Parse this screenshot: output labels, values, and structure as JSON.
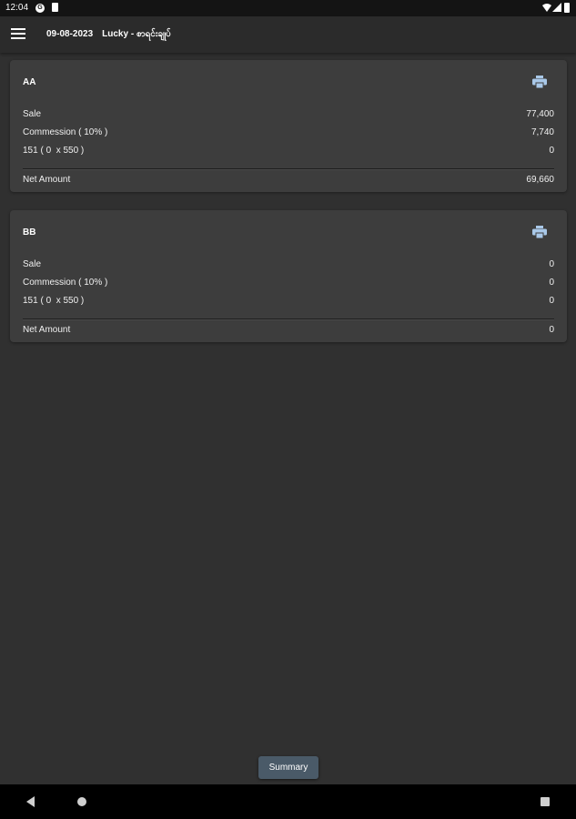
{
  "status_bar": {
    "time": "12:04",
    "g_label": "G"
  },
  "app_bar": {
    "date": "09-08-2023",
    "title": "Lucky - စာရင်းချုပ်"
  },
  "cards": [
    {
      "name": "AA",
      "sale_label": "Sale",
      "sale_value": "77,400",
      "commission_label": "Commession ( 10% )",
      "commission_value": "7,740",
      "special_label": "151 ( 0  x 550 )",
      "special_value": "0",
      "net_label": "Net Amount",
      "net_value": "69,660"
    },
    {
      "name": "BB",
      "sale_label": "Sale",
      "sale_value": "0",
      "commission_label": "Commession ( 10% )",
      "commission_value": "0",
      "special_label": "151 ( 0  x 550 )",
      "special_value": "0",
      "net_label": "Net Amount",
      "net_value": "0"
    }
  ],
  "summary_button": {
    "label": "Summary"
  },
  "icons": {
    "menu": "menu-icon",
    "print": "print-icon",
    "back": "back-icon",
    "home": "home-icon",
    "recents": "recents-icon"
  },
  "colors": {
    "background": "#303030",
    "card": "#3d3d3d",
    "app_bar": "#2b2b2b",
    "print_icon": "#a9c8e8",
    "summary_button": "#4a5a68"
  }
}
